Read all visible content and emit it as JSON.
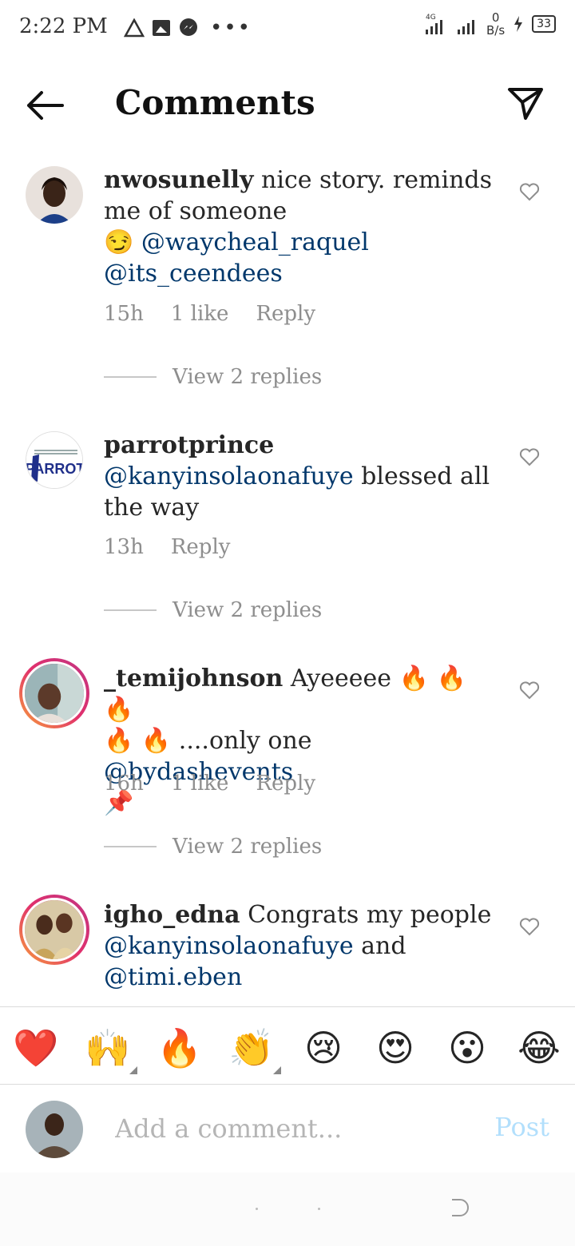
{
  "status_bar": {
    "time": "2:22 PM",
    "network": "4G",
    "net_speed_value": "0",
    "net_speed_unit": "B/s",
    "battery": "33"
  },
  "header": {
    "title": "Comments"
  },
  "comments": [
    {
      "username": "nwosunelly",
      "text": "nice story. reminds me of someone",
      "emoji": "😏",
      "mentions": [
        "@waycheal_raquel",
        "@its_ceendees"
      ],
      "time": "15h",
      "likes": "1 like",
      "reply_label": "Reply",
      "view_replies": "View 2 replies"
    },
    {
      "username": "parrotprince",
      "mention": "@kanyinsolaonafuye",
      "text": "blessed all the way",
      "avatar_text": "PARROT",
      "time": "13h",
      "reply_label": "Reply",
      "view_replies": "View 2 replies"
    },
    {
      "username": "_temijohnson",
      "text_before": "Ayeeeee",
      "fire_emojis": "🔥 🔥 🔥",
      "fire_emojis_2": "🔥 🔥",
      "text_middle": "....only one",
      "mention": "@bydashevents",
      "pin_emoji": "📌",
      "time": "16h",
      "likes": "1 like",
      "reply_label": "Reply",
      "view_replies": "View 2 replies"
    },
    {
      "username": "igho_edna",
      "text": "Congrats my people",
      "mention_1": "@kanyinsolaonafuye",
      "and": "and",
      "mention_2": "@timi.eben"
    }
  ],
  "emoji_bar": [
    "❤️",
    "🙌",
    "🔥",
    "👏",
    "😢",
    "😍",
    "😮",
    "😂"
  ],
  "comment_input": {
    "placeholder": "Add a comment...",
    "post_label": "Post"
  },
  "colors": {
    "mention": "#00376b",
    "meta": "#8e8e8e",
    "post_disabled": "#b2dffc",
    "story_ring_start": "#f8a23a",
    "story_ring_end": "#c13584"
  }
}
